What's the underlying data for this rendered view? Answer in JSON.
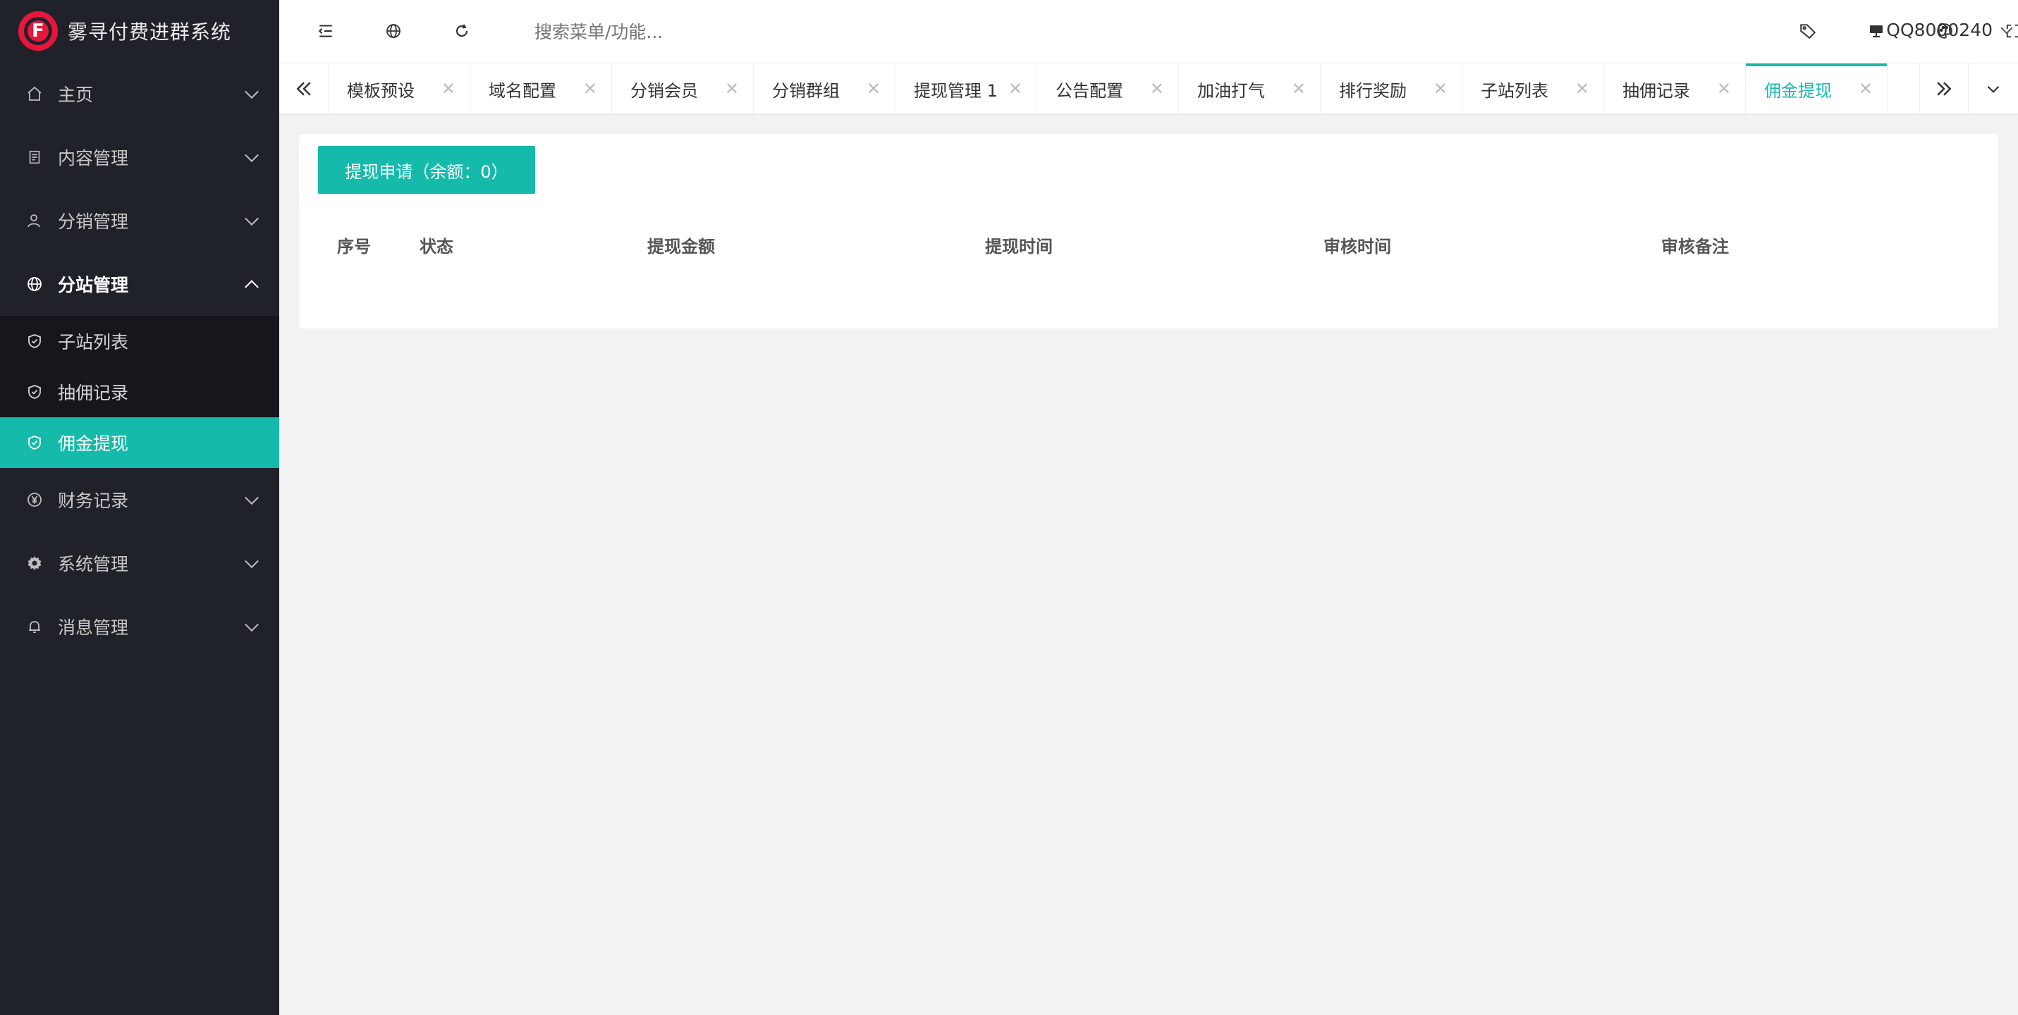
{
  "app": {
    "title": "雾寻付费进群系统",
    "logo_glyph": "F",
    "brand_color": "#e8163c",
    "accent_color": "#16baaa"
  },
  "sidebar": {
    "items": [
      {
        "label": "主页",
        "icon": "home-icon",
        "expanded": false
      },
      {
        "label": "内容管理",
        "icon": "document-icon",
        "expanded": false
      },
      {
        "label": "分销管理",
        "icon": "user-icon",
        "expanded": false
      },
      {
        "label": "分站管理",
        "icon": "globe-icon",
        "expanded": true,
        "children": [
          {
            "label": "子站列表",
            "icon": "shield-check-icon",
            "active": false
          },
          {
            "label": "抽佣记录",
            "icon": "shield-check-icon",
            "active": false
          },
          {
            "label": "佣金提现",
            "icon": "shield-check-icon",
            "active": true
          }
        ]
      },
      {
        "label": "财务记录",
        "icon": "yen-icon",
        "expanded": false
      },
      {
        "label": "系统管理",
        "icon": "gear-icon",
        "expanded": false
      },
      {
        "label": "消息管理",
        "icon": "bell-icon",
        "expanded": false
      }
    ]
  },
  "header": {
    "search_placeholder": "搜索菜单/功能...",
    "user_name": "QQ8000240",
    "left_icons": [
      "menu-fold-icon",
      "globe-icon",
      "refresh-icon"
    ],
    "right_icons": [
      "tag-icon",
      "monitor-icon",
      "palette-icon",
      "fullscreen-icon"
    ]
  },
  "tabs": [
    {
      "label": "模板预设"
    },
    {
      "label": "域名配置"
    },
    {
      "label": "分销会员"
    },
    {
      "label": "分销群组"
    },
    {
      "label": "提现管理 1"
    },
    {
      "label": "公告配置"
    },
    {
      "label": "加油打气"
    },
    {
      "label": "排行奖励"
    },
    {
      "label": "子站列表"
    },
    {
      "label": "抽佣记录"
    },
    {
      "label": "佣金提现",
      "active": true
    }
  ],
  "main": {
    "withdraw_button": "提现申请（余额：0）",
    "table_headers": [
      "序号",
      "状态",
      "提现金额",
      "提现时间",
      "审核时间",
      "审核备注"
    ]
  }
}
